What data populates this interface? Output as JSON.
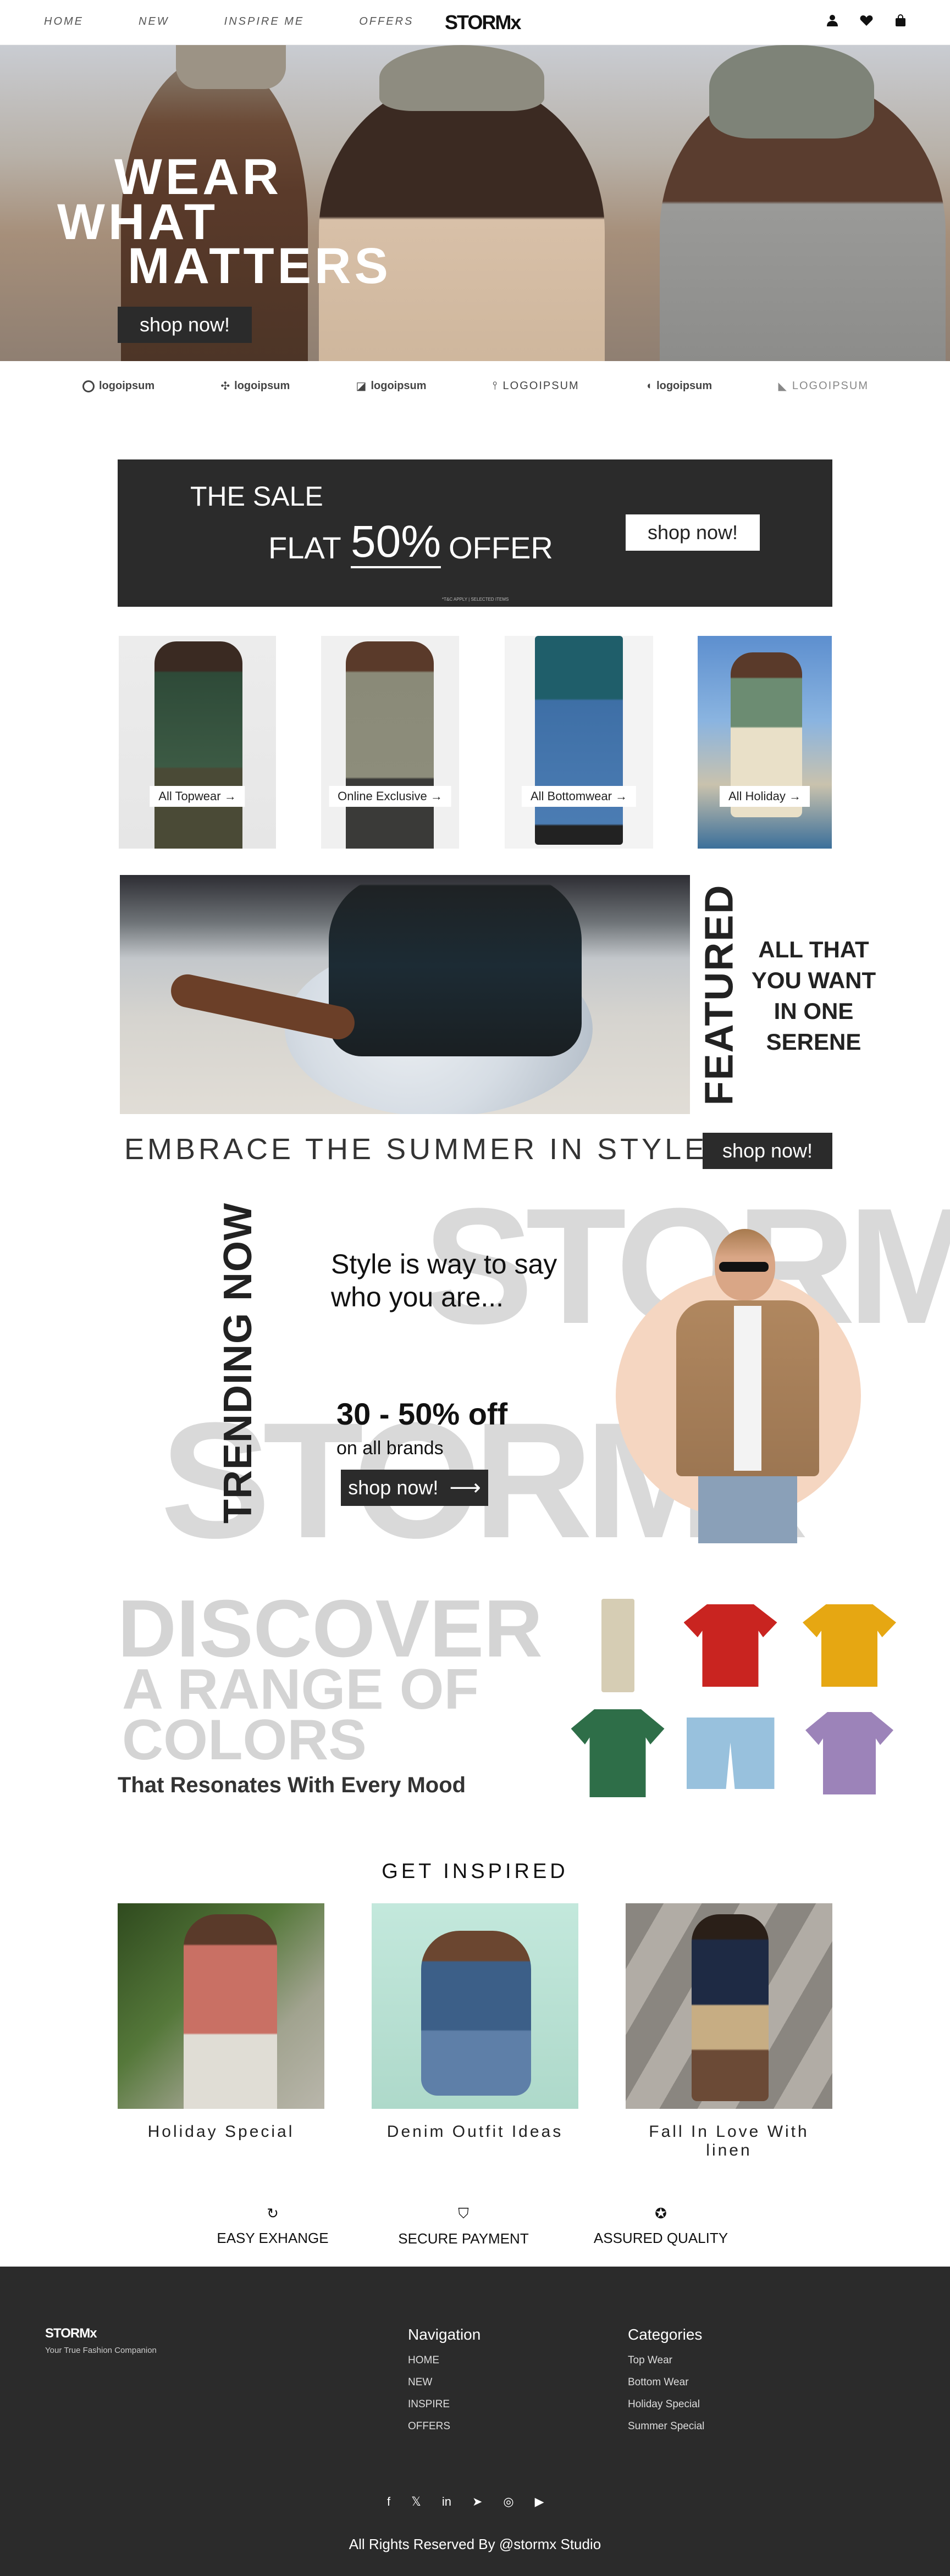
{
  "header": {
    "nav": [
      "HOME",
      "NEW",
      "INSPIRE ME",
      "OFFERS"
    ],
    "brand": "STORMx"
  },
  "hero": {
    "line1": "WEAR",
    "line2": "WHAT",
    "line3": "MATTERS",
    "cta": "shop now!"
  },
  "logos": [
    "logoipsum",
    "logoipsum",
    "logoipsum",
    "LOGOIPSUM",
    "logoipsum",
    "LOGOIPSUM"
  ],
  "sale": {
    "line1": "THE SALE",
    "flat": "FLAT",
    "percent": "50%",
    "offer": "OFFER",
    "cta": "shop now!",
    "fineprint": "*T&C APPLY | SELECTED ITEMS"
  },
  "categories": [
    {
      "label": "All Topwear"
    },
    {
      "label": "Online Exclusive"
    },
    {
      "label": "All Bottomwear"
    },
    {
      "label": "All Holiday"
    }
  ],
  "featured": {
    "vertical": "FEATURED",
    "text1": "ALL THAT",
    "text2": "YOU WANT",
    "text3": "IN ONE",
    "text4": "SERENE"
  },
  "embrace": {
    "text": "EMBRACE THE SUMMER IN STYLE",
    "cta": "shop now!"
  },
  "trending": {
    "vertical": "TRENDING NOW",
    "ghost1": "STORMx",
    "ghost2": "STORMx",
    "tagline1": "Style is way to say",
    "tagline2": "who you are...",
    "offer": "30 - 50% off",
    "offer_sub": "on all brands",
    "cta": "shop now!"
  },
  "discover": {
    "line1": "DISCOVER",
    "line2": "A RANGE OF",
    "line3": "COLORS",
    "sub": "That Resonates With Every Mood",
    "swatches": [
      "#eee1c4",
      "#f27b7b",
      "#eab23c",
      "#6bc3ac",
      "#a8d0e6",
      "#c2a9dc"
    ]
  },
  "inspired": {
    "title": "GET INSPIRED",
    "items": [
      {
        "caption": "Holiday Special"
      },
      {
        "caption": "Denim Outfit Ideas"
      },
      {
        "caption": "Fall In Love With linen"
      }
    ]
  },
  "features": [
    {
      "label": "EASY EXHANGE",
      "icon": "refresh-icon"
    },
    {
      "label": "SECURE PAYMENT",
      "icon": "shield-icon"
    },
    {
      "label": "ASSURED QUALITY",
      "icon": "badge-icon"
    }
  ],
  "footer": {
    "brand": "STORMx",
    "tagline": "Your True Fashion Companion",
    "nav_title": "Navigation",
    "nav": [
      "HOME",
      "NEW",
      "INSPIRE",
      "OFFERS"
    ],
    "cat_title": "Categories",
    "categories": [
      "Top Wear",
      "Bottom Wear",
      "Holiday Special",
      "Summer Special"
    ],
    "copyright": "All Rights Reserved By @stormx Studio"
  }
}
